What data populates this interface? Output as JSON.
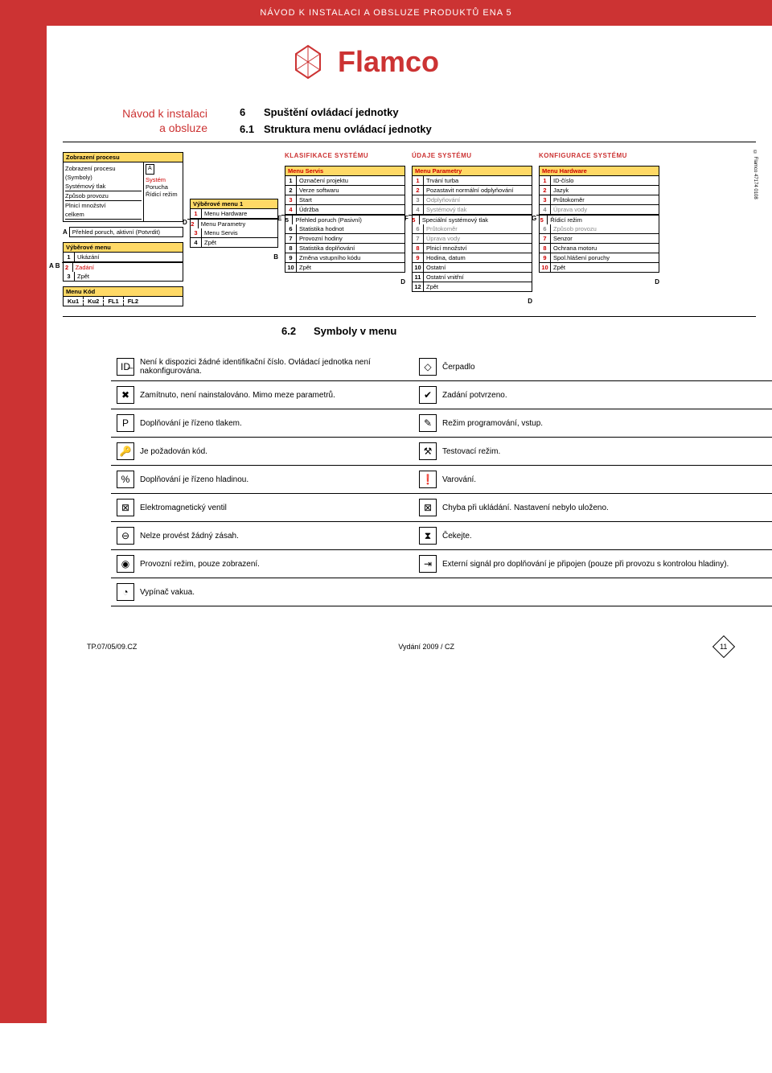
{
  "banner": "NÁVOD K INSTALACI A OBSLUZE PRODUKTŮ ENA 5",
  "brand": "Flamco",
  "intro": {
    "left1": "Návod k instalaci",
    "left2": "a obsluze",
    "r1_num": "6",
    "r1_txt": "Spuštění ovládací jednotky",
    "r2_num": "6.1",
    "r2_txt": "Struktura menu ovládací jednotky"
  },
  "proc": {
    "title": "Zobrazení procesu",
    "l1": "Zobrazení procesu",
    "l2": "(Symboly)",
    "l3": "Systémový tlak",
    "l4": "Způsob provozu",
    "l5": "Plnicí množství",
    "l6": "celkem",
    "boxA": "A",
    "sys": "Systém",
    "por": "Porucha",
    "rid": "Řídicí režim",
    "prehled": "Přehled poruch, aktivní (Potvrdit)"
  },
  "vyb": {
    "title": "Výběrové menu",
    "i1_n": "1",
    "i1_t": "Ukázání",
    "i2_n": "2",
    "i2_t": "Zadání",
    "i3_n": "3",
    "i3_t": "Zpět",
    "letterB": "B"
  },
  "kod": {
    "title": "Menu Kód",
    "c1": "Ku1",
    "c2": "Ku2",
    "c3": "FL1",
    "c4": "FL2"
  },
  "vyb1": {
    "title": "Výběrové menu 1",
    "i1_n": "1",
    "i1_t": "Menu Hardware",
    "i2_n": "2",
    "i2_t": "Menu Parametry",
    "i3_n": "3",
    "i3_t": "Menu Servis",
    "i4_n": "4",
    "i4_t": "Zpět",
    "letterD": "D",
    "letterB": "B"
  },
  "servis": {
    "sec": "KLASIFIKACE SYSTÉMU",
    "title": "Menu Servis",
    "r1_n": "1",
    "r1_t": "Označení projektu",
    "r2_n": "2",
    "r2_t": "Verze softwaru",
    "r3_n": "3",
    "r3_t": "Start",
    "r4_n": "4",
    "r4_t": "Údržba",
    "r5_n": "5",
    "r5_t": "Přehled poruch (Pasivní)",
    "r6_n": "6",
    "r6_t": "Statistika hodnot",
    "r7_n": "7",
    "r7_t": "Provozní hodiny",
    "r8_n": "8",
    "r8_t": "Statistika doplňování",
    "r9_n": "9",
    "r9_t": "Změna vstupního kódu",
    "r10_n": "10",
    "r10_t": "Zpět",
    "letterE": "E",
    "letterD": "D"
  },
  "param": {
    "sec": "ÚDAJE SYSTÉMU",
    "title": "Menu Parametry",
    "r1_n": "1",
    "r1_t": "Trvání turba",
    "r2_n": "2",
    "r2_t": "Pozastavit normální odplyňování",
    "r3_n": "3",
    "r3_t": "Odplyňování",
    "r4_n": "4",
    "r4_t": "Systémový tlak",
    "r5_n": "5",
    "r5_t": "Speciální systémový tlak",
    "r6_n": "6",
    "r6_t": "Průtokoměr",
    "r7_n": "7",
    "r7_t": "Úprava vody",
    "r8_n": "8",
    "r8_t": "Plnicí množství",
    "r9_n": "9",
    "r9_t": "Hodina, datum",
    "r10_n": "10",
    "r10_t": "Ostatní",
    "r11_n": "11",
    "r11_t": "Ostatní vnitřní",
    "r12_n": "12",
    "r12_t": "Zpět",
    "letterF": "F",
    "letterD": "D"
  },
  "hw": {
    "sec": "KONFIGURACE SYSTÉMU",
    "title": "Menu Hardware",
    "r1_n": "1",
    "r1_t": "ID-číslo",
    "r2_n": "2",
    "r2_t": "Jazyk",
    "r3_n": "3",
    "r3_t": "Průtokoměr",
    "r4_n": "4",
    "r4_t": "Úprava vody",
    "r5_n": "5",
    "r5_t": "Řídicí režim",
    "r6_n": "6",
    "r6_t": "Způsob provozu",
    "r7_n": "7",
    "r7_t": "Senzor",
    "r8_n": "8",
    "r8_t": "Ochrana motoru",
    "r9_n": "9",
    "r9_t": "Spol.hlášení poruchy",
    "r10_n": "10",
    "r10_t": "Zpět",
    "letterG": "G",
    "letterD": "D"
  },
  "sideText": "© Flamco 47174 0108",
  "sec62_num": "6.2",
  "sec62_txt": "Symboly v menu",
  "symbols": [
    {
      "l": "Není k dispozici žádné identifikační číslo. Ovládací jednotka není nakonfigurována.",
      "r": "Čerpadlo",
      "li": "ID̶",
      "ri": "◇"
    },
    {
      "l": "Zamítnuto, není nainstalováno. Mimo meze parametrů.",
      "r": "Zadání potvrzeno.",
      "li": "✖",
      "ri": "✔"
    },
    {
      "l": "Doplňování je řízeno tlakem.",
      "r": "Režim programování, vstup.",
      "li": "P",
      "ri": "✎"
    },
    {
      "l": "Je požadován kód.",
      "r": "Testovací režim.",
      "li": "🔑",
      "ri": "⚒"
    },
    {
      "l": "Doplňování je řízeno hladinou.",
      "r": "Varování.",
      "li": "%",
      "ri": "❗"
    },
    {
      "l": "Elektromagnetický ventil",
      "r": "Chyba při ukládání. Nastavení nebylo uloženo.",
      "li": "⊠",
      "ri": "⊠"
    },
    {
      "l": "Nelze provést žádný zásah.",
      "r": "Čekejte.",
      "li": "⊖",
      "ri": "⧗"
    },
    {
      "l": "Provozní režim, pouze zobrazení.",
      "r": "Externí signál pro doplňování je připojen (pouze při provozu s kontrolou hladiny).",
      "li": "◉",
      "ri": "⇥"
    },
    {
      "l": "Vypínač vakua.",
      "r": "",
      "li": "◔",
      "ri": ""
    }
  ],
  "footer": {
    "left": "TP.07/05/09.CZ",
    "mid": "Vydání 2009 / CZ",
    "page": "11"
  }
}
